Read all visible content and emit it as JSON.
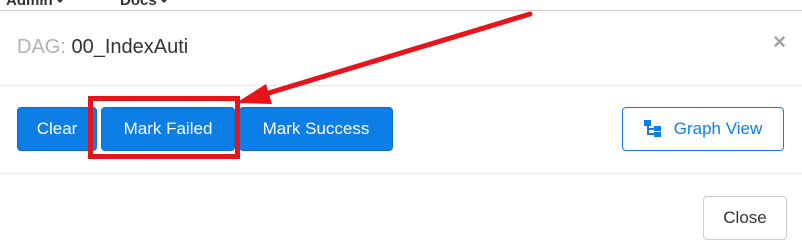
{
  "nav": {
    "admin_label": "Admin",
    "docs_label": "Docs"
  },
  "modal": {
    "title_prefix": "DAG:",
    "title_value": "00_IndexAuti",
    "close_symbol": "×"
  },
  "actions": {
    "clear_label": "Clear",
    "mark_failed_label": "Mark Failed",
    "mark_success_label": "Mark Success",
    "graph_view_label": "Graph View"
  },
  "footer": {
    "close_label": "Close"
  },
  "annotation": {
    "highlight_color": "#e8141c",
    "target": "Mark Failed"
  },
  "colors": {
    "primary": "#0c7ee6"
  },
  "icons": {
    "graph_view": "sitemap-icon",
    "close": "close-icon",
    "dropdown": "caret-down-icon"
  }
}
